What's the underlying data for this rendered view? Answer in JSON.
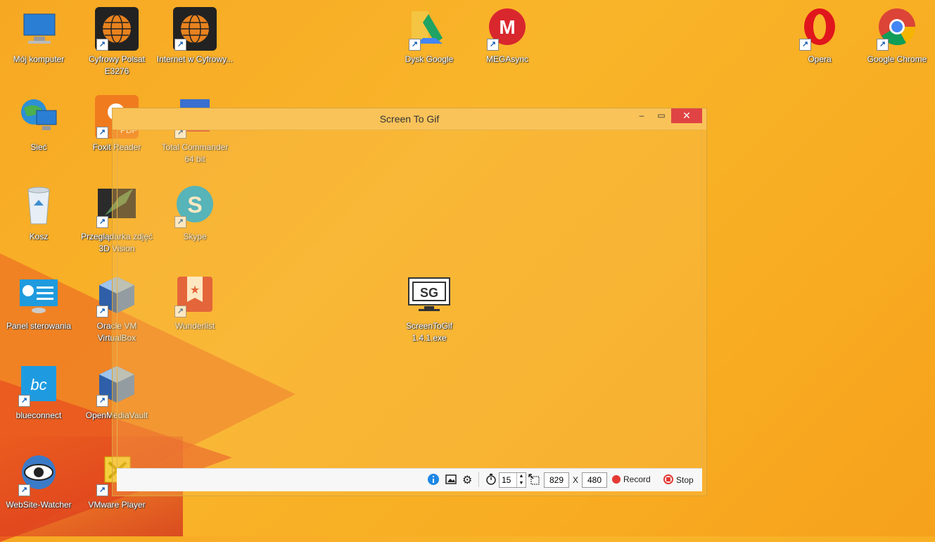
{
  "desktop_icons": [
    {
      "label": "Mój komputer",
      "icon": "computer-icon"
    },
    {
      "label": "Cyfrowy Polsat E3276",
      "icon": "globe-icon"
    },
    {
      "label": "Internet w Cyfrowy...",
      "icon": "globe-icon"
    },
    {
      "label": "Dysk Google",
      "icon": "drive-icon"
    },
    {
      "label": "MEGAsync",
      "icon": "mega-icon"
    },
    {
      "label": "Opera",
      "icon": "opera-icon"
    },
    {
      "label": "Google Chrome",
      "icon": "chrome-icon"
    },
    {
      "label": "Sieć",
      "icon": "network-icon"
    },
    {
      "label": "Foxit Reader",
      "icon": "pdf-icon"
    },
    {
      "label": "Total Commander 64 bit",
      "icon": "total-commander-icon"
    },
    {
      "label": "Kosz",
      "icon": "recycle-bin-icon"
    },
    {
      "label": "Przeglądarka zdjęć 3D Vision",
      "icon": "3d-vision-icon"
    },
    {
      "label": "Skype",
      "icon": "skype-icon"
    },
    {
      "label": "Panel sterowania",
      "icon": "control-panel-icon"
    },
    {
      "label": "Oracle VM VirtualBox",
      "icon": "virtualbox-icon"
    },
    {
      "label": "Wunderlist",
      "icon": "wunderlist-icon"
    },
    {
      "label": "ScreenToGif 1.4.1.exe",
      "icon": "screentogif-icon"
    },
    {
      "label": "blueconnect",
      "icon": "blueconnect-icon"
    },
    {
      "label": "OpenMediaVault",
      "icon": "virtualbox-icon"
    },
    {
      "label": "WebSite-Watcher",
      "icon": "eye-icon"
    },
    {
      "label": "VMware Player",
      "icon": "vmware-icon"
    }
  ],
  "window": {
    "title": "Screen To Gif",
    "toolbar": {
      "fps": "15",
      "width": "829",
      "x_sep": "X",
      "height": "480",
      "record_label": "Record",
      "stop_label": "Stop"
    }
  },
  "colors": {
    "record": "#e53935",
    "info": "#1e88e5"
  }
}
